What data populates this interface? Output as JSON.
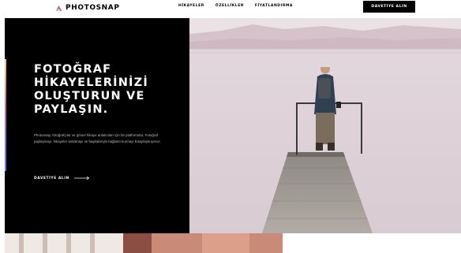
{
  "header": {
    "logo_text": "PHOTOSNAP",
    "nav": [
      "HİKAYELER",
      "ÖZELLİKLER",
      "FİYATLANDIRMA"
    ],
    "cta_label": "DAVETİYE ALIN"
  },
  "hero": {
    "title_lines": [
      "FOTOĞRAF",
      "HİKAYELERİNİZİ",
      "OLUŞTURUN VE",
      "PAYLAŞIN."
    ],
    "description": "Photosnap, fotoğrafçılar ve görsel hikaye anlatıcıları için bir platformdur. Fotoğraf paylaşmayı, hikayeler anlatmayı ve başkalarıyla bağlantı kurmayı kolaylaştırıyoruz.",
    "link_label": "DAVETİYE ALIN"
  },
  "icons": {
    "logo": "photosnap-logo-icon",
    "arrow": "arrow-right-icon"
  },
  "colors": {
    "black": "#000000",
    "white": "#ffffff",
    "gradient_start": "#ffc593",
    "gradient_mid": "#bc7198",
    "gradient_end": "#5a77ff"
  }
}
